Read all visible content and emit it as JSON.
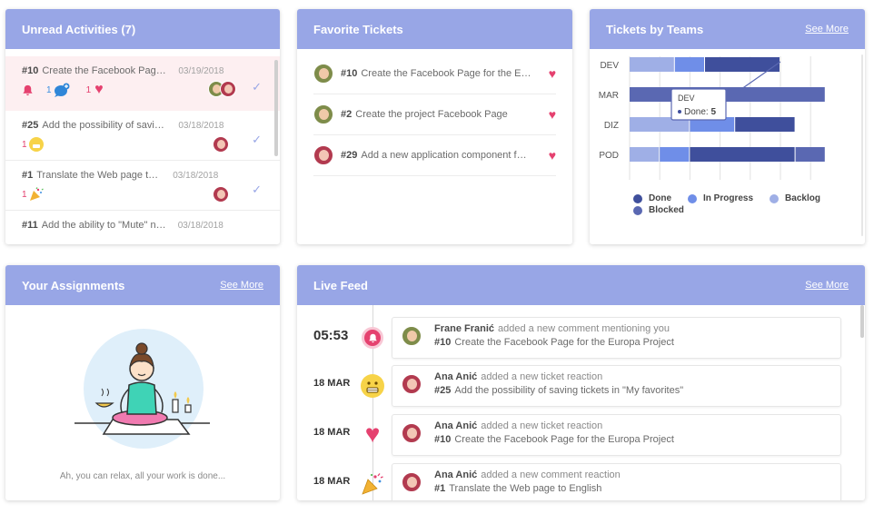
{
  "unread": {
    "title": "Unread Activities (7)",
    "items": [
      {
        "id": "#10",
        "title": "Create the Facebook Page for the Europa Project",
        "date": "03/19/2018",
        "bell_count": "1",
        "comment_count": "1",
        "heart_count": "1"
      },
      {
        "id": "#25",
        "title": "Add the possibility of saving tickets in \"My favorites\"",
        "date": "03/18/2018",
        "reaction_count": "1"
      },
      {
        "id": "#1",
        "title": "Translate the Web page to English",
        "date": "03/18/2018",
        "reaction_count": "1"
      },
      {
        "id": "#11",
        "title": "Add the ability to \"Mute\" notifications",
        "date": "03/18/2018"
      }
    ]
  },
  "favorites": {
    "title": "Favorite Tickets",
    "items": [
      {
        "id": "#10",
        "title": "Create the Facebook Page for the Europa Project"
      },
      {
        "id": "#2",
        "title": "Create the project Facebook Page"
      },
      {
        "id": "#29",
        "title": "Add a new application component for mentions"
      }
    ]
  },
  "teams": {
    "title": "Tickets by Teams",
    "see_more": "See More",
    "tooltip_team": "DEV",
    "tooltip_label": "Done:",
    "tooltip_value": "5",
    "legend": [
      {
        "label": "Done",
        "color": "#3f4f9c"
      },
      {
        "label": "In Progress",
        "color": "#6f8ee8"
      },
      {
        "label": "Backlog",
        "color": "#9fafe6"
      },
      {
        "label": "Blocked",
        "color": "#5a68b2"
      }
    ]
  },
  "chart_data": {
    "type": "bar",
    "orientation": "horizontal",
    "stacked": true,
    "title": "Tickets by Teams",
    "categories": [
      "DEV",
      "MAR",
      "DIZ",
      "POD"
    ],
    "series": [
      {
        "name": "Backlog",
        "color": "#9fafe6",
        "values": [
          3,
          0,
          4,
          2
        ]
      },
      {
        "name": "In Progress",
        "color": "#6f8ee8",
        "values": [
          2,
          0,
          3,
          2
        ]
      },
      {
        "name": "Done",
        "color": "#3f4f9c",
        "values": [
          5,
          0,
          4,
          7
        ]
      },
      {
        "name": "Blocked",
        "color": "#5a68b2",
        "values": [
          0,
          13,
          0,
          2
        ]
      }
    ],
    "grid": true
  },
  "assignments": {
    "title": "Your Assignments",
    "see_more": "See More",
    "empty_text": "Ah, you can relax, all your work is done..."
  },
  "feed": {
    "title": "Live Feed",
    "see_more": "See More",
    "items": [
      {
        "time": "05:53",
        "name": "Frane Franić",
        "action": "added a new comment mentioning you",
        "ticket_id": "#10",
        "ticket_title": "Create the Facebook Page for the Europa Project",
        "marker": "bell-icon"
      },
      {
        "time": "18 MAR",
        "name": "Ana Anić",
        "action": "added a new ticket reaction",
        "ticket_id": "#25",
        "ticket_title": "Add the possibility of saving tickets in \"My favorites\"",
        "marker": "grimace-emoji-icon"
      },
      {
        "time": "18 MAR",
        "name": "Ana Anić",
        "action": "added a new ticket reaction",
        "ticket_id": "#10",
        "ticket_title": "Create the Facebook Page for the Europa Project",
        "marker": "heart-icon"
      },
      {
        "time": "18 MAR",
        "name": "Ana Anić",
        "action": "added a new comment reaction",
        "ticket_id": "#1",
        "ticket_title": "Translate the Web page to English",
        "marker": "party-popper-icon"
      }
    ]
  },
  "colors": {
    "header": "#98a6e6",
    "accent": "#e5416f",
    "highlight": "#fdeff1"
  }
}
